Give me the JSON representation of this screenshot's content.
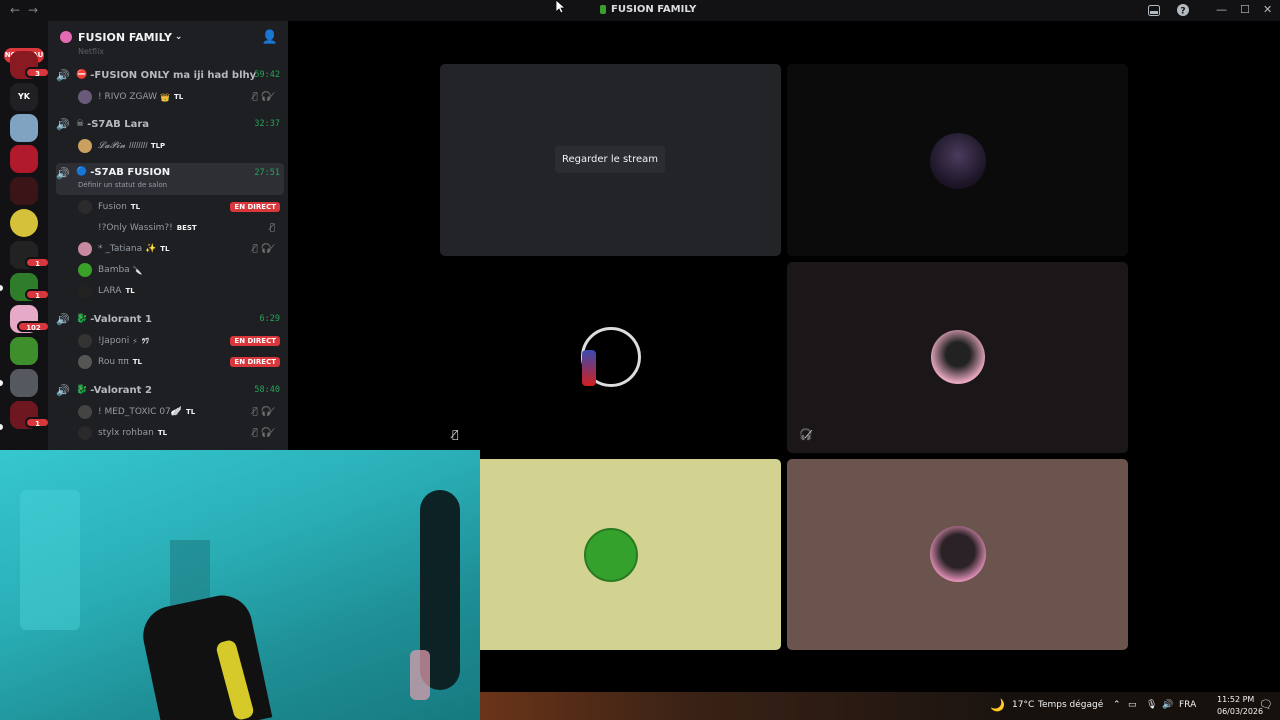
{
  "titlebar": {
    "back_icon": "arrow-left-icon",
    "forward_icon": "arrow-right-icon",
    "title": "FUSION FAMILY",
    "inbox_icon": "inbox-icon",
    "help_icon": "help-icon",
    "minimize_icon": "minimize-icon",
    "maximize_icon": "maximize-icon",
    "close_icon": "close-icon"
  },
  "rail": {
    "new_badge": "NOUVEAU",
    "servers": [
      {
        "badge": "3",
        "color": "#8a1a22"
      },
      {
        "badge": "",
        "color": "#1f1f24"
      },
      {
        "badge": "",
        "color": "#7fa3c0"
      },
      {
        "badge": "",
        "color": "#b01a2c"
      },
      {
        "badge": "",
        "color": "#3a1416"
      },
      {
        "badge": "",
        "color": "#d6c23a"
      },
      {
        "badge": "1",
        "color": "#222"
      },
      {
        "badge": "1",
        "color": "#2f7d2a"
      },
      {
        "badge": "102",
        "color": "#e6a9c8"
      },
      {
        "badge": "",
        "color": "#3e8f2c"
      },
      {
        "badge": "",
        "color": "#55585e"
      },
      {
        "badge": "1",
        "color": "#6e1720"
      }
    ]
  },
  "guild": {
    "name": "FUSION FAMILY",
    "chevron_icon": "chevron-down-icon",
    "invite_icon": "add-member-icon",
    "cut_off_channel": "Netflix"
  },
  "channels": [
    {
      "name": "-FUSION ONLY ma iji had blhy",
      "emoji": "⛔",
      "timer": "59:42",
      "users": [
        {
          "name": "! RIVO ZGAW",
          "tag": "TL",
          "extra": "👑",
          "status": "muted",
          "avatar": "#6a5a7a"
        }
      ]
    },
    {
      "name": "-S7AB Lara",
      "emoji": "☠",
      "timer": "32:37",
      "users": [
        {
          "name": "𝓛𝓪𝓟𝓲𝓷 𝖨𝖨𝖨𝖨𝖨𝖨𝖨𝖨",
          "tag": "TLP",
          "extra": "",
          "status": "",
          "avatar": "#c9a060"
        }
      ]
    },
    {
      "name": "-S7AB FUSION",
      "emoji": "🔵",
      "timer": "27:51",
      "status_hint": "Définir un statut de salon",
      "users": [
        {
          "name": "Fusion",
          "tag": "TL",
          "extra": "",
          "status": "live",
          "avatar": "#2b2b2b"
        },
        {
          "name": "!?Only Wassim?!",
          "tag": "BEST",
          "extra": "",
          "status": "muted-single",
          "avatar": "#1e1f22"
        },
        {
          "name": "* _Tatiana ✨",
          "tag": "TL",
          "extra": "",
          "status": "muted",
          "avatar": "#c78aa0"
        },
        {
          "name": "Bamba",
          "tag": "",
          "extra": "🔪",
          "status": "",
          "avatar": "#3aa02a"
        },
        {
          "name": "LARA",
          "tag": "TL",
          "extra": "",
          "status": "",
          "avatar": "#222"
        }
      ]
    },
    {
      "name": "-Valorant 1",
      "emoji": "🐉",
      "timer": "6:29",
      "users": [
        {
          "name": "!Japoni",
          "tag": "ﾂﾜ",
          "extra": "⚡",
          "status": "live",
          "avatar": "#333"
        },
        {
          "name": "Rou ππ",
          "tag": "TL",
          "extra": "",
          "status": "live",
          "avatar": "#555"
        }
      ]
    },
    {
      "name": "-Valorant 2",
      "emoji": "🐉",
      "timer": "58:40",
      "users": [
        {
          "name": "! MED_TOXIC 07🪽",
          "tag": "TL",
          "extra": "",
          "status": "muted",
          "avatar": "#444"
        },
        {
          "name": "stylx rohban",
          "tag": "TL",
          "extra": "",
          "status": "muted",
          "avatar": "#2a2a2a"
        }
      ]
    }
  ],
  "labels": {
    "live": "EN DIRECT",
    "muted_icons": "🎙̸🎧̸",
    "muted_single": "🎙̸"
  },
  "stage": {
    "watch_stream": "Regarder le stream"
  },
  "taskbar": {
    "weather_icon": "moon-icon",
    "temperature": "17°C",
    "weather": "Temps dégagé",
    "language": "FRA",
    "time": "11:52 PM",
    "date": "06/03/2026",
    "notification_icon": "notification-icon"
  }
}
